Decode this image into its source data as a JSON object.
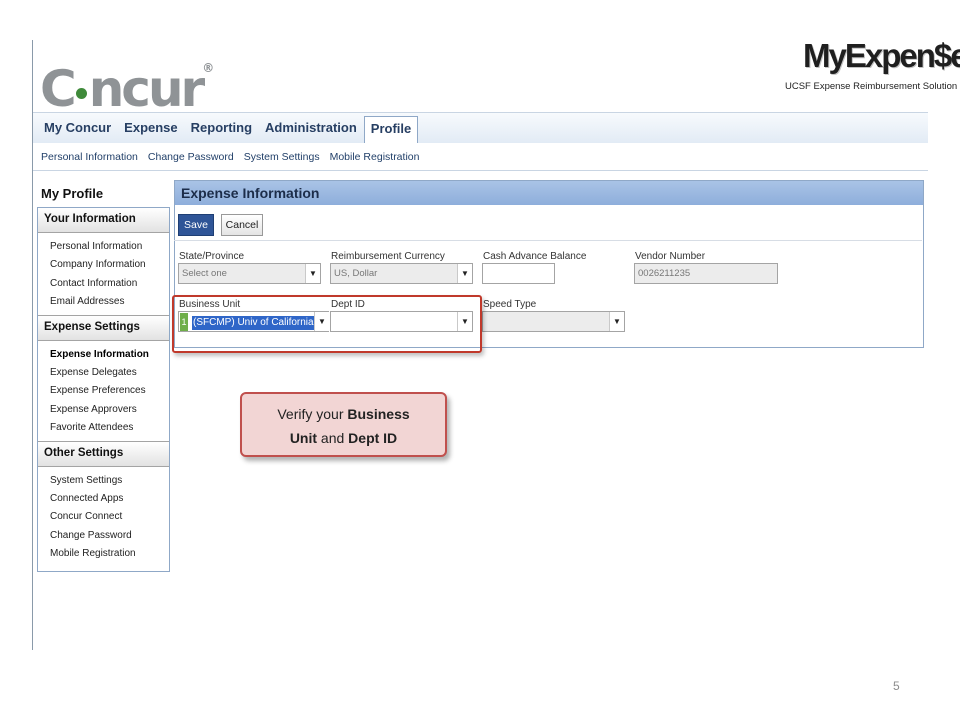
{
  "header": {
    "logo_left": "Concur",
    "logo_pre": "C",
    "logo_post": "ncur",
    "brand_title": "MyExpen$e",
    "brand_subtitle": "UCSF Expense Reimbursement Solution"
  },
  "main_nav": {
    "tabs": [
      {
        "label": "My Concur"
      },
      {
        "label": "Expense"
      },
      {
        "label": "Reporting"
      },
      {
        "label": "Administration"
      },
      {
        "label": "Profile",
        "active": true
      }
    ]
  },
  "sub_nav": {
    "items": [
      "Personal Information",
      "Change Password",
      "System Settings",
      "Mobile Registration"
    ]
  },
  "sidebar": {
    "title": "My Profile",
    "sections": [
      {
        "heading": "Your Information",
        "items": [
          "Personal Information",
          "Company Information",
          "Contact Information",
          "Email Addresses"
        ]
      },
      {
        "heading": "Expense Settings",
        "items": [
          "Expense Information",
          "Expense Delegates",
          "Expense Preferences",
          "Expense Approvers",
          "Favorite Attendees"
        ],
        "active_item": "Expense Information"
      },
      {
        "heading": "Other Settings",
        "items": [
          "System Settings",
          "Connected Apps",
          "Concur Connect",
          "Change Password",
          "Mobile Registration"
        ]
      }
    ]
  },
  "panel": {
    "title": "Expense Information",
    "save_label": "Save",
    "cancel_label": "Cancel",
    "fields": {
      "state_label": "State/Province",
      "state_value": "Select one",
      "currency_label": "Reimbursement Currency",
      "currency_value": "US, Dollar",
      "cash_label": "Cash Advance Balance",
      "cash_value": "",
      "vendor_label": "Vendor Number",
      "vendor_value": "0026211235",
      "bu_label": "Business Unit",
      "bu_value": "(SFCMP) Univ of California CAMPUS",
      "bu_marker": "1",
      "dept_label": "Dept ID",
      "dept_value": "",
      "speed_label": "Speed Type",
      "speed_value": ""
    }
  },
  "callout": {
    "text_1": "Verify your ",
    "text_2": "Business",
    "text_3": "Unit",
    "text_4": " and ",
    "text_5": "Dept ID"
  },
  "slide": {
    "page_number": "5"
  },
  "colors": {
    "nav_text": "#273f63",
    "panel_header": "#8eaedb",
    "save_button": "#2f5597",
    "highlight": "#c0392b",
    "callout_fill": "#f2d5d4",
    "logo_dot": "#3f8a3a"
  },
  "icons": {
    "dropdown": "chevron-down-icon"
  }
}
